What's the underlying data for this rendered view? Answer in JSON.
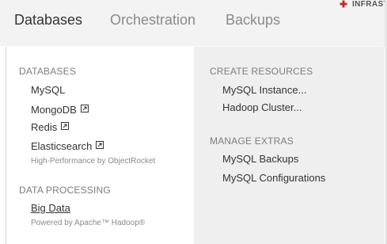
{
  "nav": {
    "tabs": [
      {
        "label": "Databases",
        "active": true
      },
      {
        "label": "Orchestration",
        "active": false
      },
      {
        "label": "Backups",
        "active": false
      }
    ],
    "infra_label": "INFRAST"
  },
  "menu": {
    "left": {
      "databases_heading": "DATABASES",
      "items": [
        {
          "label": "MySQL",
          "external": false
        },
        {
          "label": "MongoDB",
          "external": true
        },
        {
          "label": "Redis",
          "external": true
        },
        {
          "label": "Elasticsearch",
          "external": true
        }
      ],
      "elasticsearch_note": "High-Performance by ObjectRocket",
      "data_processing_heading": "DATA PROCESSING",
      "big_data": "Big Data",
      "big_data_note": "Powered by Apache™ Hadoop®"
    },
    "right": {
      "create_heading": "CREATE RESOURCES",
      "create_items": [
        "MySQL Instance...",
        "Hadoop Cluster..."
      ],
      "manage_heading": "MANAGE EXTRAS",
      "manage_items": [
        "MySQL Backups",
        "MySQL Configurations"
      ]
    }
  },
  "colors": {
    "nav_bg": "#f3f3f3",
    "right_panel_bg": "#efefef",
    "accent_red": "#cc2222"
  },
  "icons": {
    "external_link": "external-link-icon",
    "infra": "plus-icon"
  }
}
